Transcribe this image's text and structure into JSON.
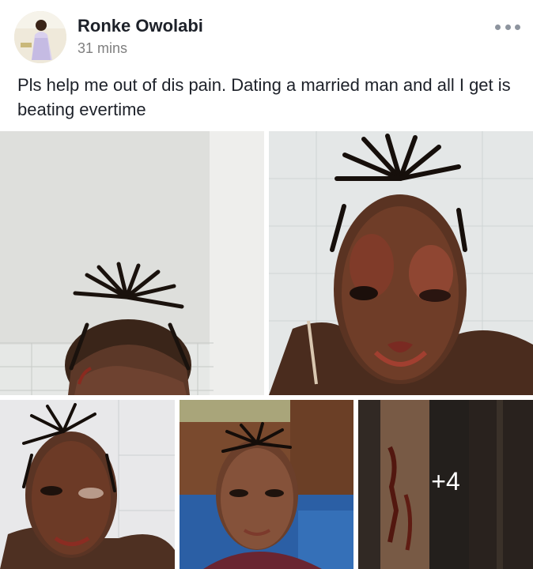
{
  "post": {
    "author": "Ronke Owolabi",
    "time": "31 mins",
    "text": "Pls help me out of dis pain. Dating a married man and all I get is beating evertime"
  },
  "photos": {
    "more_count": "+4"
  },
  "colors": {
    "author_text": "#1d2129",
    "meta_text": "#7f7f7f",
    "menu_dots": "#8d949e"
  },
  "icons": {
    "menu": "more-horizontal-icon"
  }
}
